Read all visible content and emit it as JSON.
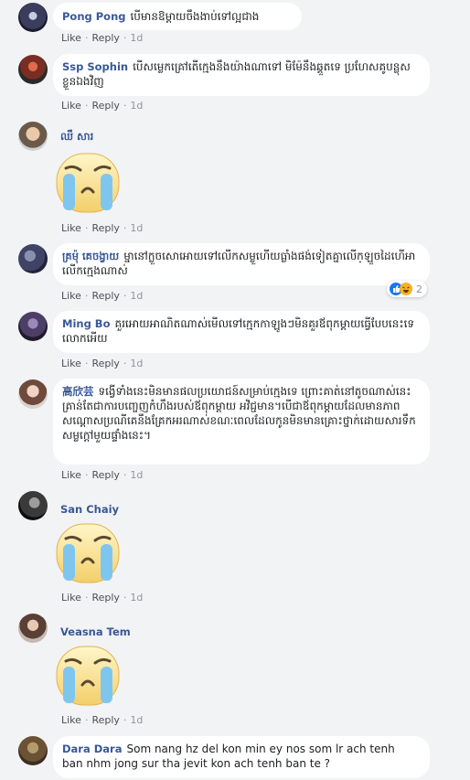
{
  "actions": {
    "like": "Like",
    "reply": "Reply",
    "sep": "·"
  },
  "comments": [
    {
      "author": "Pong Pong",
      "text": "បើមានឱម្តាយចឹងងាប់ទៅល្អជាង",
      "time": "1d"
    },
    {
      "author": "Ssp Sophin",
      "text": "បើសម្លេកគ្រៅតើក្មេងនឹងយ៉ាងណាទៅ មិម៉ែនឹងឆ្គួតទេ ប្រហែសគូបន្លុសខ្លួនឯងវិញ",
      "time": "1d"
    },
    {
      "author": "ឈឹ សារ",
      "text": "",
      "time": "1d",
      "sticker": "crying-face-sticker"
    },
    {
      "author": "គ្រម៉ុ គេចង្វាយ",
      "text": "ម្នានៅក្លួចសោអោយទៅលើកសម្លួហើយធ្លាំងផង់ទៀតគ្នាលើក្ឡួចដៃហើអាលើកក្មេងណាស់",
      "time": "1d",
      "reaction_count": "2"
    },
    {
      "author": "Ming Bo",
      "text": "គួរអោយអាណិតណាស់មើលទៅក្មេកកាឡូងៗមិនគួរឪពុកម្តាយធ្វើបែបនេះទេលោកអើយ",
      "time": "1d"
    },
    {
      "author": "高欣芸",
      "text": "ទង្វើទាំងនេះមិនមានផលប្រយោជន៍សម្រាប់ក្មេងទេ ព្រោះគាត់នៅតូចណាស់នេះគ្រាន់តែជាការបញ្ចេញកំហឹងរបស់ឪពុកម្តាយ អវិជ្ជមាន។បើជាឪពុកម្តាយដែលមានភាពសណ្តោសប្រណីគេនឹងគ្រែកអរណាស់ខណៈពេលដែលកូនមិនមានគ្រោះថ្នាក់ដោយសារទឹកសម្លក្តៅមួយផ្ទាំងនេះ។",
      "time": "1d"
    },
    {
      "author": "San Chaiy",
      "text": "",
      "time": "1d",
      "sticker": "crying-face-sticker"
    },
    {
      "author": "Veasna Tem",
      "text": "",
      "time": "1d",
      "sticker": "crying-face-sticker"
    },
    {
      "author": "Dara Dara",
      "text": "Som nang hz del kon min ey nos som lr ach tenh ban nhm jong sur tha jevit kon ach tenh ban te ?",
      "time": ""
    }
  ],
  "colors": {
    "author": "#385898",
    "background": "#f2f3f5",
    "like_reaction": "#1877f2",
    "haha_reaction": "#f7b125"
  }
}
